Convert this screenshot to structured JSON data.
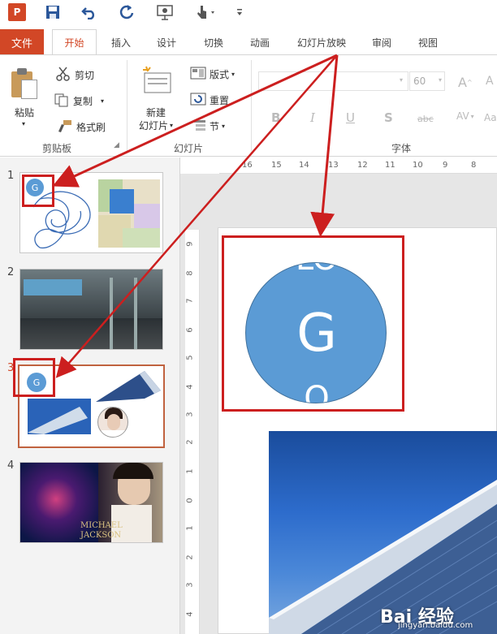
{
  "app": {
    "logo_letter": "P"
  },
  "qat": {
    "icons": [
      "save-icon",
      "undo-icon",
      "redo-icon",
      "present-icon",
      "touch-mode-icon",
      "customize-icon"
    ]
  },
  "tabs": {
    "file": "文件",
    "items": [
      "开始",
      "插入",
      "设计",
      "切换",
      "动画",
      "幻灯片放映",
      "审阅",
      "视图"
    ],
    "active": "开始"
  },
  "ribbon": {
    "clipboard": {
      "paste": "粘贴",
      "cut": "剪切",
      "copy": "复制",
      "format_painter": "格式刷",
      "label": "剪贴板"
    },
    "slides": {
      "new_slide_line1": "新建",
      "new_slide_line2": "幻灯片",
      "layout": "版式",
      "reset": "重置",
      "section": "节",
      "label": "幻灯片"
    },
    "font": {
      "size": "60",
      "bold": "B",
      "italic": "I",
      "underline": "U",
      "shadow": "S",
      "strike": "abc",
      "spacing": "AV",
      "label": "字体"
    }
  },
  "slides_panel": {
    "numbers": [
      "1",
      "2",
      "3",
      "4"
    ],
    "active_index": 3,
    "thumb1_letter": "G",
    "thumb3_letter": "G",
    "thumb4_title_line1": "MICHAEL",
    "thumb4_title_line2": "JACKSON"
  },
  "ruler": {
    "h_ticks": [
      "16",
      "15",
      "14",
      "13",
      "12",
      "11",
      "10",
      "9",
      "8"
    ],
    "v_ticks": [
      "9",
      "8",
      "7",
      "6",
      "5",
      "4",
      "3",
      "2",
      "1",
      "0",
      "1",
      "2",
      "3",
      "4"
    ]
  },
  "canvas": {
    "circle_letter": "G",
    "circle_top_text": "LO",
    "circle_bottom_text": "O"
  },
  "watermark": {
    "text": "Bai 经验",
    "url": "jingyan.baidu.com"
  },
  "colors": {
    "accent": "#d24726",
    "circle": "#5b9bd5",
    "highlight": "#cc1f1f"
  }
}
